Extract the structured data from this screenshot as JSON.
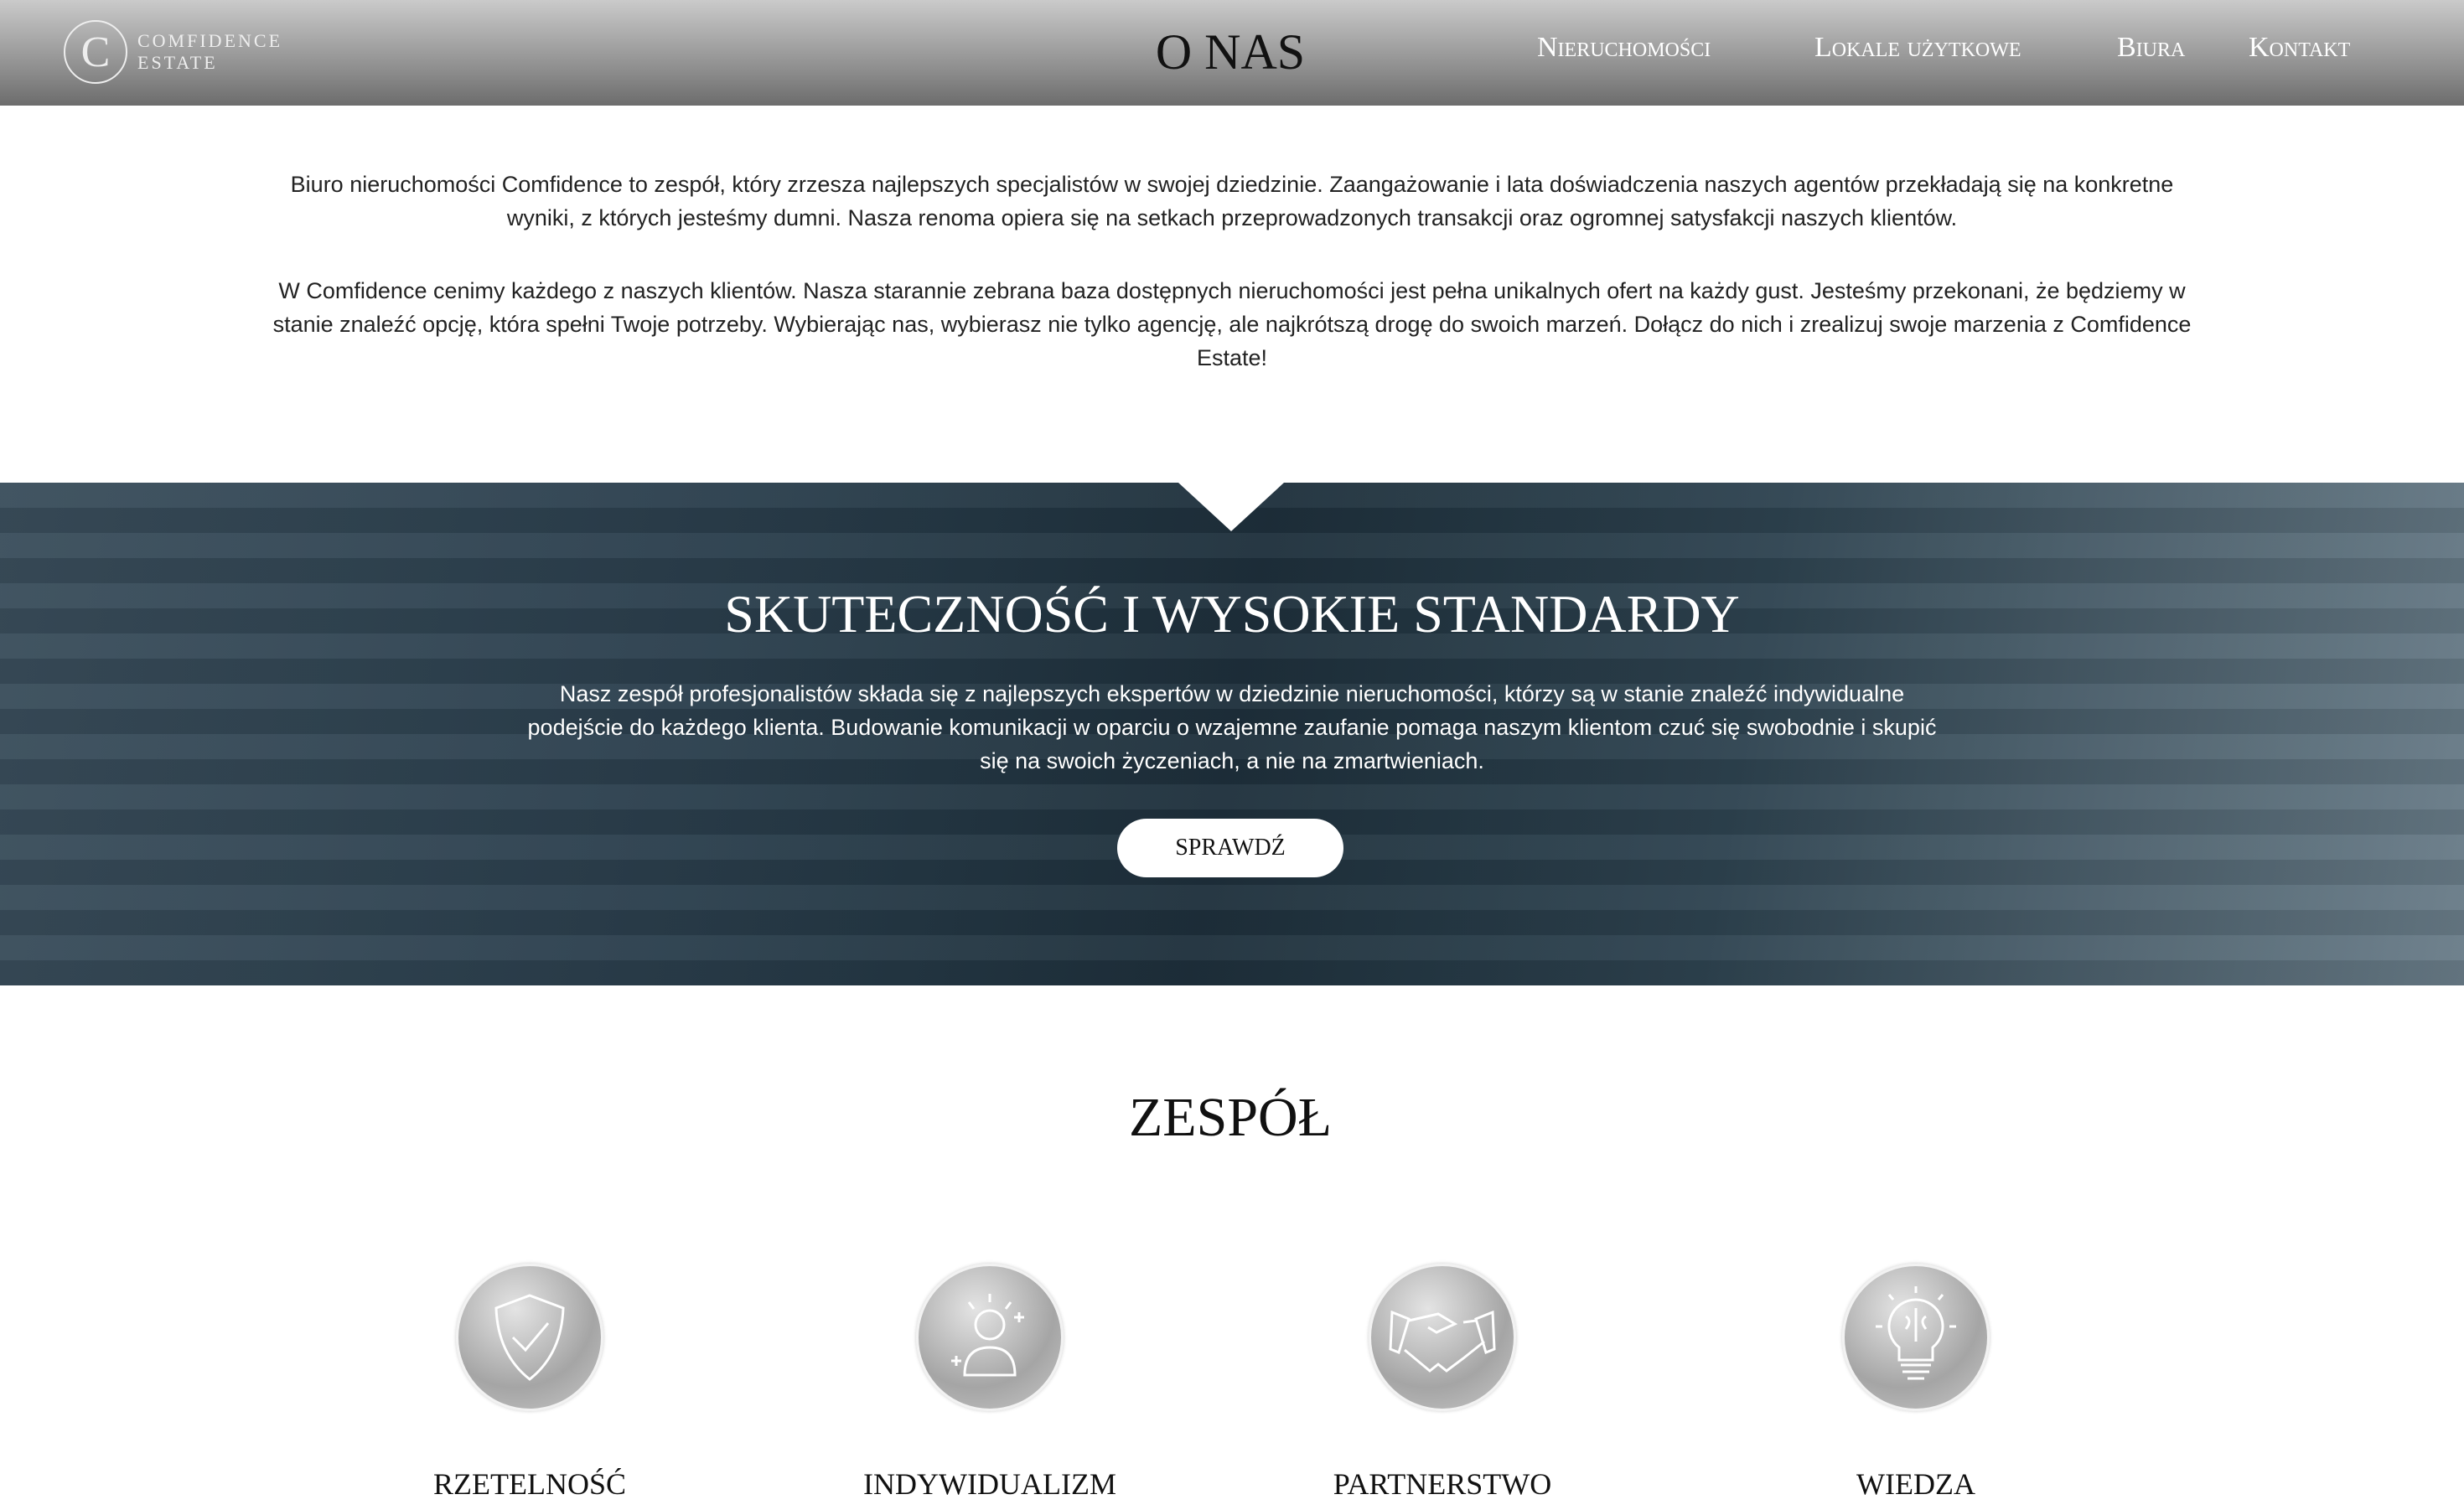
{
  "header": {
    "logo_letter": "C",
    "logo_line1": "COMFIDENCE",
    "logo_line2": "ESTATE",
    "title": "O NAS",
    "nav": [
      "Nieruchomości",
      "Lokale użytkowe",
      "Biura",
      "Kontakt"
    ]
  },
  "intro": {
    "p1": "Biuro nieruchomości Comfidence to zespół, który zrzesza najlepszych specjalistów w swojej dziedzinie. Zaangażowanie i lata doświadczenia naszych agentów przekładają się na konkretne wyniki, z których jesteśmy dumni. Nasza renoma opiera się na setkach przeprowadzonych transakcji oraz ogromnej satysfakcji naszych klientów.",
    "p2": "W Comfidence cenimy każdego z naszych klientów. Nasza starannie zebrana baza dostępnych nieruchomości jest pełna unikalnych ofert na każdy gust. Jesteśmy przekonani, że będziemy w stanie znaleźć opcję, która spełni Twoje potrzeby. Wybierając nas, wybierasz nie tylko agencję, ale najkrótszą drogę do swoich marzeń. Dołącz do nich i zrealizuj swoje marzenia z Comfidence Estate!"
  },
  "band": {
    "heading": "SKUTECZNOŚĆ I WYSOKIE STANDARDY",
    "text": "Nasz zespół profesjonalistów składa się z najlepszych ekspertów w dziedzinie nieruchomości, którzy są w stanie znaleźć indywidualne podejście do każdego klienta. Budowanie komunikacji w oparciu o wzajemne zaufanie pomaga naszym klientom czuć się swobodnie i skupić się na swoich życzeniach, a nie na zmartwieniach.",
    "button": "SPRAWDŹ"
  },
  "team": {
    "heading": "ZESPÓŁ",
    "values": [
      {
        "label": "RZETELNOŚĆ",
        "icon": "shield-check-icon"
      },
      {
        "label": "INDYWIDUALIZM",
        "icon": "person-sparkle-icon"
      },
      {
        "label": "PARTNERSTWO",
        "icon": "handshake-icon"
      },
      {
        "label": "WIEDZA",
        "icon": "lightbulb-brain-icon"
      }
    ]
  }
}
